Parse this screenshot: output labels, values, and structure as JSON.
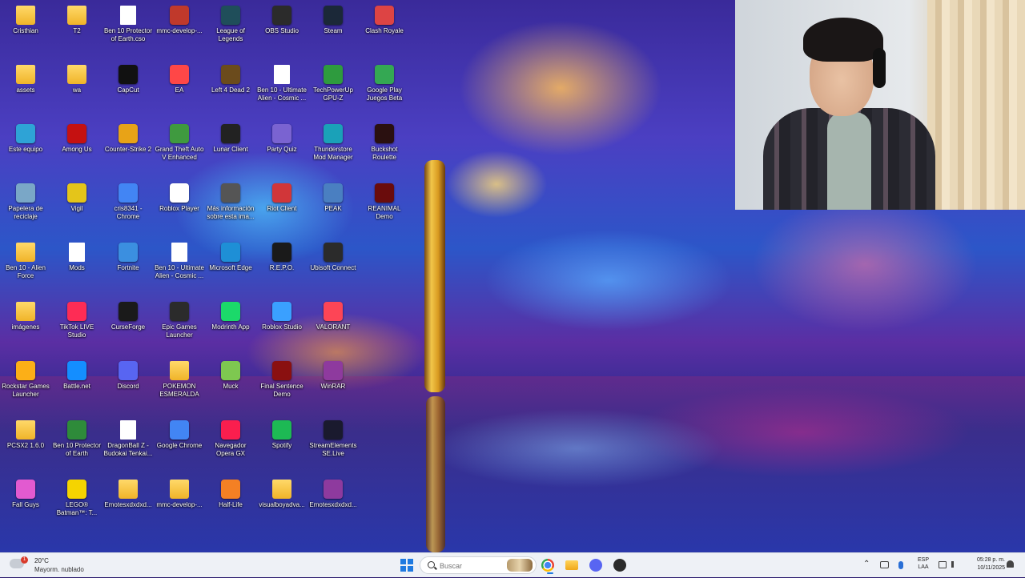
{
  "desktop": {
    "icons": [
      {
        "label": "Cristhian",
        "kind": "folder",
        "color": "#f0b429"
      },
      {
        "label": "T2",
        "kind": "folder",
        "color": "#f0b429"
      },
      {
        "label": "Ben 10 Protector of Earth.cso",
        "kind": "file",
        "color": "#ffffff"
      },
      {
        "label": "mmc-develop-...",
        "kind": "app",
        "color": "#c0392b"
      },
      {
        "label": "League of Legends",
        "kind": "app",
        "color": "#1f4e5a"
      },
      {
        "label": "OBS Studio",
        "kind": "app",
        "color": "#2b2b2b"
      },
      {
        "label": "Steam",
        "kind": "app",
        "color": "#1b2838"
      },
      {
        "label": "Clash Royale",
        "kind": "app",
        "color": "#d44"
      },
      {
        "label": "assets",
        "kind": "folder",
        "color": "#f0b429"
      },
      {
        "label": "wa",
        "kind": "folder",
        "color": "#3a3a3a"
      },
      {
        "label": "CapCut",
        "kind": "app",
        "color": "#111111"
      },
      {
        "label": "EA",
        "kind": "app",
        "color": "#ff4747"
      },
      {
        "label": "Left 4 Dead 2",
        "kind": "app",
        "color": "#6b4b1c"
      },
      {
        "label": "Ben 10 - Ultimate Alien - Cosmic ...",
        "kind": "file",
        "color": "#ffffff"
      },
      {
        "label": "TechPowerUp GPU-Z",
        "kind": "app",
        "color": "#2e9b3e"
      },
      {
        "label": "Google Play Juegos Beta",
        "kind": "app",
        "color": "#34a853"
      },
      {
        "label": "Este equipo",
        "kind": "app",
        "color": "#2ea3d6"
      },
      {
        "label": "Among Us",
        "kind": "app",
        "color": "#c51111"
      },
      {
        "label": "Counter-Strike 2",
        "kind": "app",
        "color": "#e8a317"
      },
      {
        "label": "Grand Theft Auto V Enhanced",
        "kind": "app",
        "color": "#3f9a3f"
      },
      {
        "label": "Lunar Client",
        "kind": "app",
        "color": "#222222"
      },
      {
        "label": "Party Quiz",
        "kind": "app",
        "color": "#7a63d1"
      },
      {
        "label": "Thunderstore Mod Manager",
        "kind": "app",
        "color": "#1aa1b8"
      },
      {
        "label": "Buckshot Roulette",
        "kind": "app",
        "color": "#2a1010"
      },
      {
        "label": "Papelera de reciclaje",
        "kind": "app",
        "color": "#7aa7c7"
      },
      {
        "label": "Vigil",
        "kind": "app",
        "color": "#e4c51a"
      },
      {
        "label": "cris8341 - Chrome",
        "kind": "app",
        "color": "#4285f4"
      },
      {
        "label": "Roblox Player",
        "kind": "app",
        "color": "#ffffff"
      },
      {
        "label": "Más información sobre esta ima...",
        "kind": "app",
        "color": "#555555"
      },
      {
        "label": "Riot Client",
        "kind": "app",
        "color": "#d13639"
      },
      {
        "label": "PEAK",
        "kind": "app",
        "color": "#4a7fc1"
      },
      {
        "label": "REANIMAL Demo",
        "kind": "app",
        "color": "#6a0c0c"
      },
      {
        "label": "Ben 10 - Alien Force",
        "kind": "folder",
        "color": "#f0b429"
      },
      {
        "label": "Mods",
        "kind": "file",
        "color": "#ffffff"
      },
      {
        "label": "Fortnite",
        "kind": "app",
        "color": "#3b8fe0"
      },
      {
        "label": "Ben 10 - Ultimate Alien - Cosmic ...",
        "kind": "file",
        "color": "#ffffff"
      },
      {
        "label": "Microsoft Edge",
        "kind": "app",
        "color": "#1e8fd6"
      },
      {
        "label": "R.E.P.O.",
        "kind": "app",
        "color": "#1a1a1a"
      },
      {
        "label": "Ubisoft Connect",
        "kind": "app",
        "color": "#2b2b2b"
      },
      {
        "label": "",
        "kind": "none",
        "color": ""
      },
      {
        "label": "imágenes",
        "kind": "folder",
        "color": "#f0b429"
      },
      {
        "label": "TikTok LIVE Studio",
        "kind": "app",
        "color": "#fe2c55"
      },
      {
        "label": "CurseForge",
        "kind": "app",
        "color": "#1a1a1a"
      },
      {
        "label": "Epic Games Launcher",
        "kind": "app",
        "color": "#2b2b2b"
      },
      {
        "label": "Modrinth App",
        "kind": "app",
        "color": "#1bd96a"
      },
      {
        "label": "Roblox Studio",
        "kind": "app",
        "color": "#3aa0ff"
      },
      {
        "label": "VALORANT",
        "kind": "app",
        "color": "#fd4556"
      },
      {
        "label": "",
        "kind": "none",
        "color": ""
      },
      {
        "label": "Rockstar Games Launcher",
        "kind": "app",
        "color": "#fcaf17"
      },
      {
        "label": "Battle.net",
        "kind": "app",
        "color": "#148eff"
      },
      {
        "label": "Discord",
        "kind": "app",
        "color": "#5865f2"
      },
      {
        "label": "POKEMON ESMERALDA",
        "kind": "folder",
        "color": "#f0b429"
      },
      {
        "label": "Muck",
        "kind": "app",
        "color": "#7ec850"
      },
      {
        "label": "Final Sentence Demo",
        "kind": "app",
        "color": "#8a1010"
      },
      {
        "label": "WinRAR",
        "kind": "app",
        "color": "#8e3a9e"
      },
      {
        "label": "",
        "kind": "none",
        "color": ""
      },
      {
        "label": "PCSX2 1.6.0",
        "kind": "folder",
        "color": "#f0b429"
      },
      {
        "label": "Ben 10 Protector of Earth",
        "kind": "app",
        "color": "#2e8b3a"
      },
      {
        "label": "DragonBall Z - Budokai Tenkai...",
        "kind": "file",
        "color": "#ffffff"
      },
      {
        "label": "Google Chrome",
        "kind": "app",
        "color": "#4285f4"
      },
      {
        "label": "Navegador Opera GX",
        "kind": "app",
        "color": "#fa1e4e"
      },
      {
        "label": "Spotify",
        "kind": "app",
        "color": "#1db954"
      },
      {
        "label": "StreamElements SE.Live",
        "kind": "app",
        "color": "#1a1a2e"
      },
      {
        "label": "",
        "kind": "none",
        "color": ""
      },
      {
        "label": "Fall Guys",
        "kind": "app",
        "color": "#e25ad0"
      },
      {
        "label": "LEGO® Batman™: T...",
        "kind": "app",
        "color": "#f5d400"
      },
      {
        "label": "Emotesxdxdxd...",
        "kind": "folder",
        "color": "#f0b429"
      },
      {
        "label": "mmc-develop-...",
        "kind": "folder",
        "color": "#f0b429"
      },
      {
        "label": "Half-Life",
        "kind": "app",
        "color": "#f48024"
      },
      {
        "label": "visualboyadva...",
        "kind": "folder",
        "color": "#f0b429"
      },
      {
        "label": "Emotesxdxdxd...",
        "kind": "app",
        "color": "#8e3a9e"
      },
      {
        "label": "",
        "kind": "none",
        "color": ""
      }
    ]
  },
  "taskbar": {
    "weather": {
      "temp": "20°C",
      "condition": "Mayorm. nublado",
      "badge": "1"
    },
    "search_placeholder": "Buscar",
    "pinned": [
      "chrome-icon",
      "file-explorer-icon",
      "discord-icon",
      "obs-icon"
    ],
    "language": {
      "line1": "ESP",
      "line2": "LAA"
    },
    "clock": {
      "time": "05:28 p. m.",
      "date": "10/11/2025"
    }
  }
}
